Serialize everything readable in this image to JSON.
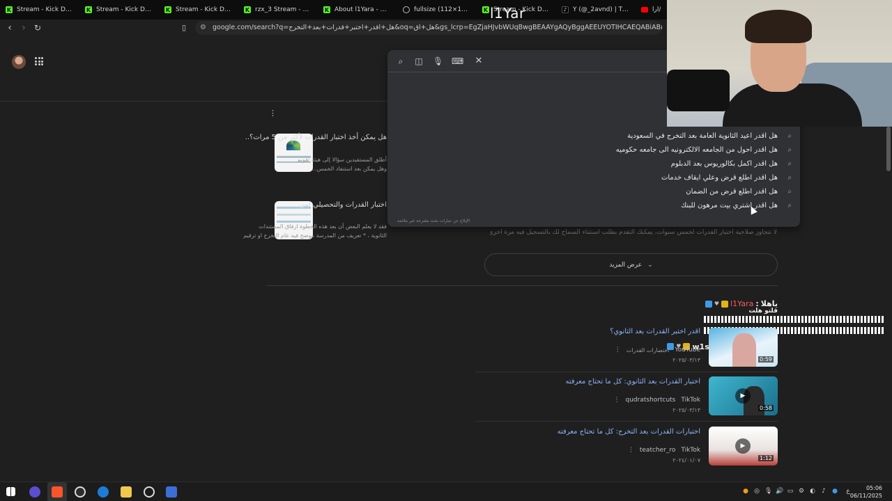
{
  "browser": {
    "tabs": [
      {
        "label": "Stream - Kick Dashboa",
        "icon": "kick-icon"
      },
      {
        "label": "Stream - Kick Dashboa",
        "icon": "kick-icon"
      },
      {
        "label": "Stream - Kick Dashboa",
        "icon": "kick-icon"
      },
      {
        "label": "rzx_3 Stream - Watch l",
        "icon": "kick-icon"
      },
      {
        "label": "About l1Yara - Watch L",
        "icon": "kick-icon"
      },
      {
        "label": "fullsize (112×112)",
        "icon": "globe-icon"
      },
      {
        "label": "Stream - Kick Dashboa",
        "icon": "kick-icon"
      },
      {
        "label": "Y (@_2avnd) | TikTok",
        "icon": "tiktok-icon"
      },
      {
        "label": "ارا/",
        "icon": "youtube-icon"
      }
    ],
    "address": "google.com/search?q=هل+اقدر+اختبر+قدرات+بعد+التخرج&oq=هل+اق&gs_lcrp=EgZjaHJvbWUqBwgBEAAYgAQyBggAEEUYOTIHCAEQABiABDIHCAIQABiAB..."
  },
  "stream_overlay": {
    "name": "l1Yar",
    "chat": [
      {
        "user": "l1Yara",
        "sep": ":",
        "message": "ياهلا",
        "submessage": "قلتو هلت"
      },
      {
        "user": "w1sarah",
        "sep": ":",
        "message": ""
      }
    ]
  },
  "search_dropdown": {
    "suggestions": [
      "هل اقدر اعيد الثانوية العامة بعد التخرج في السعودية",
      "هل اقدر احول من الجامعه الالكترونيه الى جامعه حكوميه",
      "هل اقدر اكمل بكالوريوس بعد الدبلوم",
      "هل اقدر اطلع قرض وعلي ايقاف خدمات",
      "هل اقدر اطلع قرض من الضمان",
      "هل اقدر اشتري بيت مرهون للبنك"
    ],
    "report_text": "الإبلاغ عن عبارات بحث مقترحة غير ملائمة"
  },
  "results": {
    "cards": [
      {
        "title": "هل يمكن أخذ اختبار القدرات لأكثر من 5 مرات؟..",
        "snippet1": "أطلق المستفيدين سؤالا إلى هيئة تقويم",
        "snippet2": "وهل يمكن بعد استنفاد الخمس..."
      },
      {
        "title": "اختبار القدرات والتحصيلي لمن",
        "snippet1": "فقد لا يعلم البعض أن بعد هذه الخطوة ارفاق المستندات",
        "snippet2": "الثانوية ، * تعريف من المدرسة موضح فيه عام التخرج او ترقيم"
      }
    ],
    "peek_text": "لا تتجاوز صلاحية اختبار القدرات لخمس سنوات، يمكنك التقدم بطلب استثناء السماح لك بالتسجيل فيه مرة أخرى.",
    "show_more_label": "عرض المزيد"
  },
  "videos": [
    {
      "title": "اقدر اختبر القدرات بعد الثانوي؟",
      "source": "YouTube",
      "channel": "اختصارات القدرات",
      "date": "٢٠٢٥/٠٣/١٣",
      "duration": "0:59"
    },
    {
      "title": "اختبار القدرات بعد الثانوي: كل ما تحتاج معرفته",
      "source": "TikTok",
      "channel": "qudratshortcuts",
      "date": "٢٠٢٥/٠٣/١٣",
      "duration": "0:58"
    },
    {
      "title": "اختبارات القدرات بعد التخرج: كل ما تحتاج معرفته",
      "source": "TikTok",
      "channel": "teatcher_ro",
      "date": "٢٠٢٤/٠١/٠٧",
      "duration": "1:12"
    }
  ],
  "taskbar": {
    "time": "05:06",
    "date": "06/11/2025",
    "lang": "ع"
  },
  "colors": {
    "kick": "#53fc18",
    "link": "#8ab4f8",
    "chat_user": "#ff5a5a"
  }
}
